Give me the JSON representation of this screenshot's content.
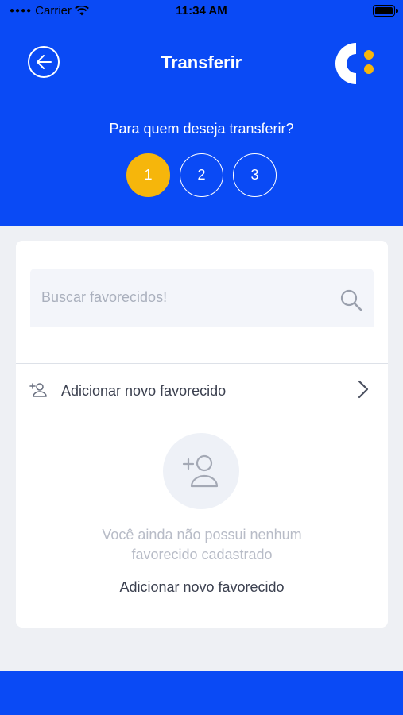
{
  "status_bar": {
    "carrier": "Carrier",
    "time": "11:34 AM"
  },
  "header": {
    "title": "Transferir",
    "prompt": "Para quem deseja transferir?",
    "steps": [
      "1",
      "2",
      "3"
    ],
    "active_step": "1"
  },
  "search": {
    "placeholder": "Buscar favorecidos!"
  },
  "add_row": {
    "label": "Adicionar novo favorecido"
  },
  "empty_state": {
    "message_line1": "Você ainda não possui nenhum",
    "message_line2": "favorecido cadastrado",
    "link_label": "Adicionar novo favorecido"
  },
  "colors": {
    "brand_blue": "#0a4af5",
    "accent_yellow": "#f6b60b"
  }
}
